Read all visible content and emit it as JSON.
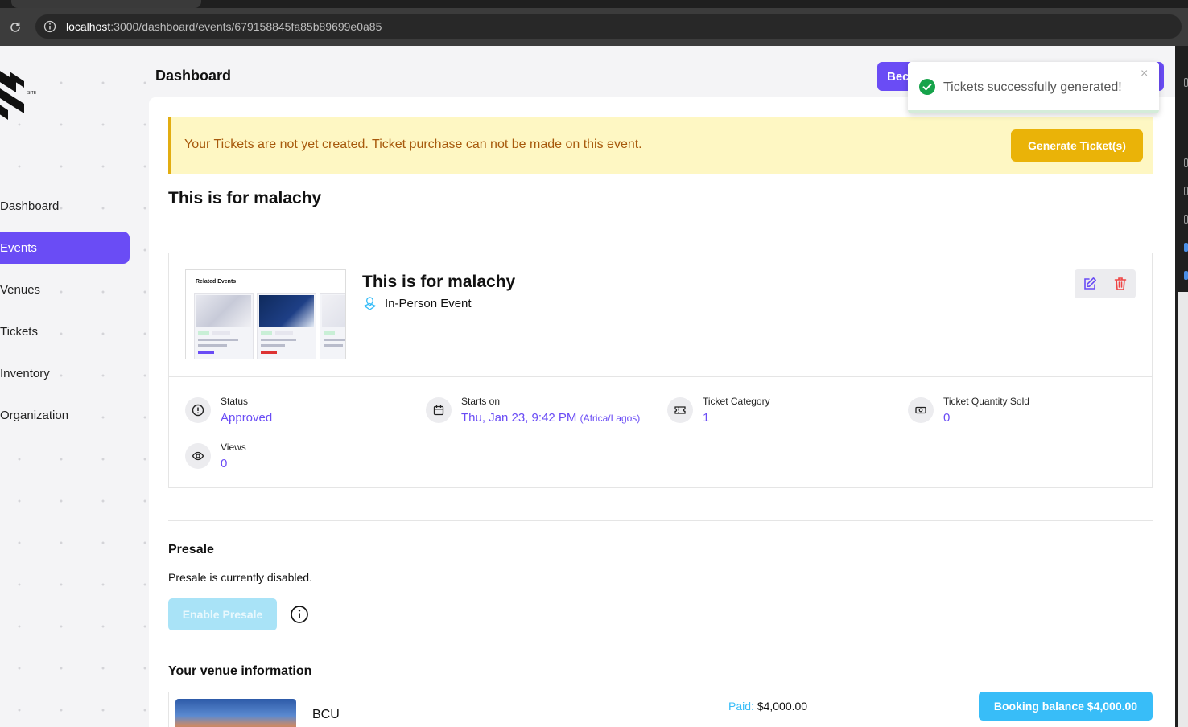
{
  "browser": {
    "url_host": "localhost",
    "url_path": ":3000/dashboard/events/679158845fa85b89699e0a85"
  },
  "sidebar": {
    "logo_text": "SITE",
    "items": [
      {
        "label": "Dashboard"
      },
      {
        "label": "Events"
      },
      {
        "label": "Venues"
      },
      {
        "label": "Tickets"
      },
      {
        "label": "Inventory"
      },
      {
        "label": "Organization"
      }
    ],
    "active_index": 1
  },
  "header": {
    "title": "Dashboard",
    "become_button_label": "Bec"
  },
  "toast": {
    "message": "Tickets successfully generated!",
    "close_label": "×"
  },
  "alert": {
    "message": "Your Tickets are not yet created. Ticket purchase can not be made on this event.",
    "button_label": "Generate Ticket(s)"
  },
  "event": {
    "page_title": "This is for malachy",
    "name": "This is for malachy",
    "type": "In-Person Event",
    "thumbnail_title": "Related Events",
    "stats": [
      {
        "label": "Status",
        "value": "Approved"
      },
      {
        "label": "Starts on",
        "value": "Thu, Jan 23, 9:42 PM",
        "tz": "(Africa/Lagos)"
      },
      {
        "label": "Ticket Category",
        "value": "1"
      },
      {
        "label": "Ticket Quantity Sold",
        "value": "0"
      },
      {
        "label": "Views",
        "value": "0"
      }
    ]
  },
  "presale": {
    "heading": "Presale",
    "status_text": "Presale is currently disabled.",
    "button_label": "Enable Presale"
  },
  "venue": {
    "heading": "Your venue information",
    "name": "BCU",
    "paid_label": "Paid:",
    "paid_amount": "$4,000.00",
    "balance_button_label": "Booking balance $4,000.00"
  },
  "colors": {
    "primary": "#6a4cf5",
    "warning_bg": "#fef7c3",
    "warning_accent": "#e2ad11",
    "generate_button": "#eab308",
    "info": "#38bdf8",
    "success": "#16a34a",
    "danger": "#ef4444"
  }
}
